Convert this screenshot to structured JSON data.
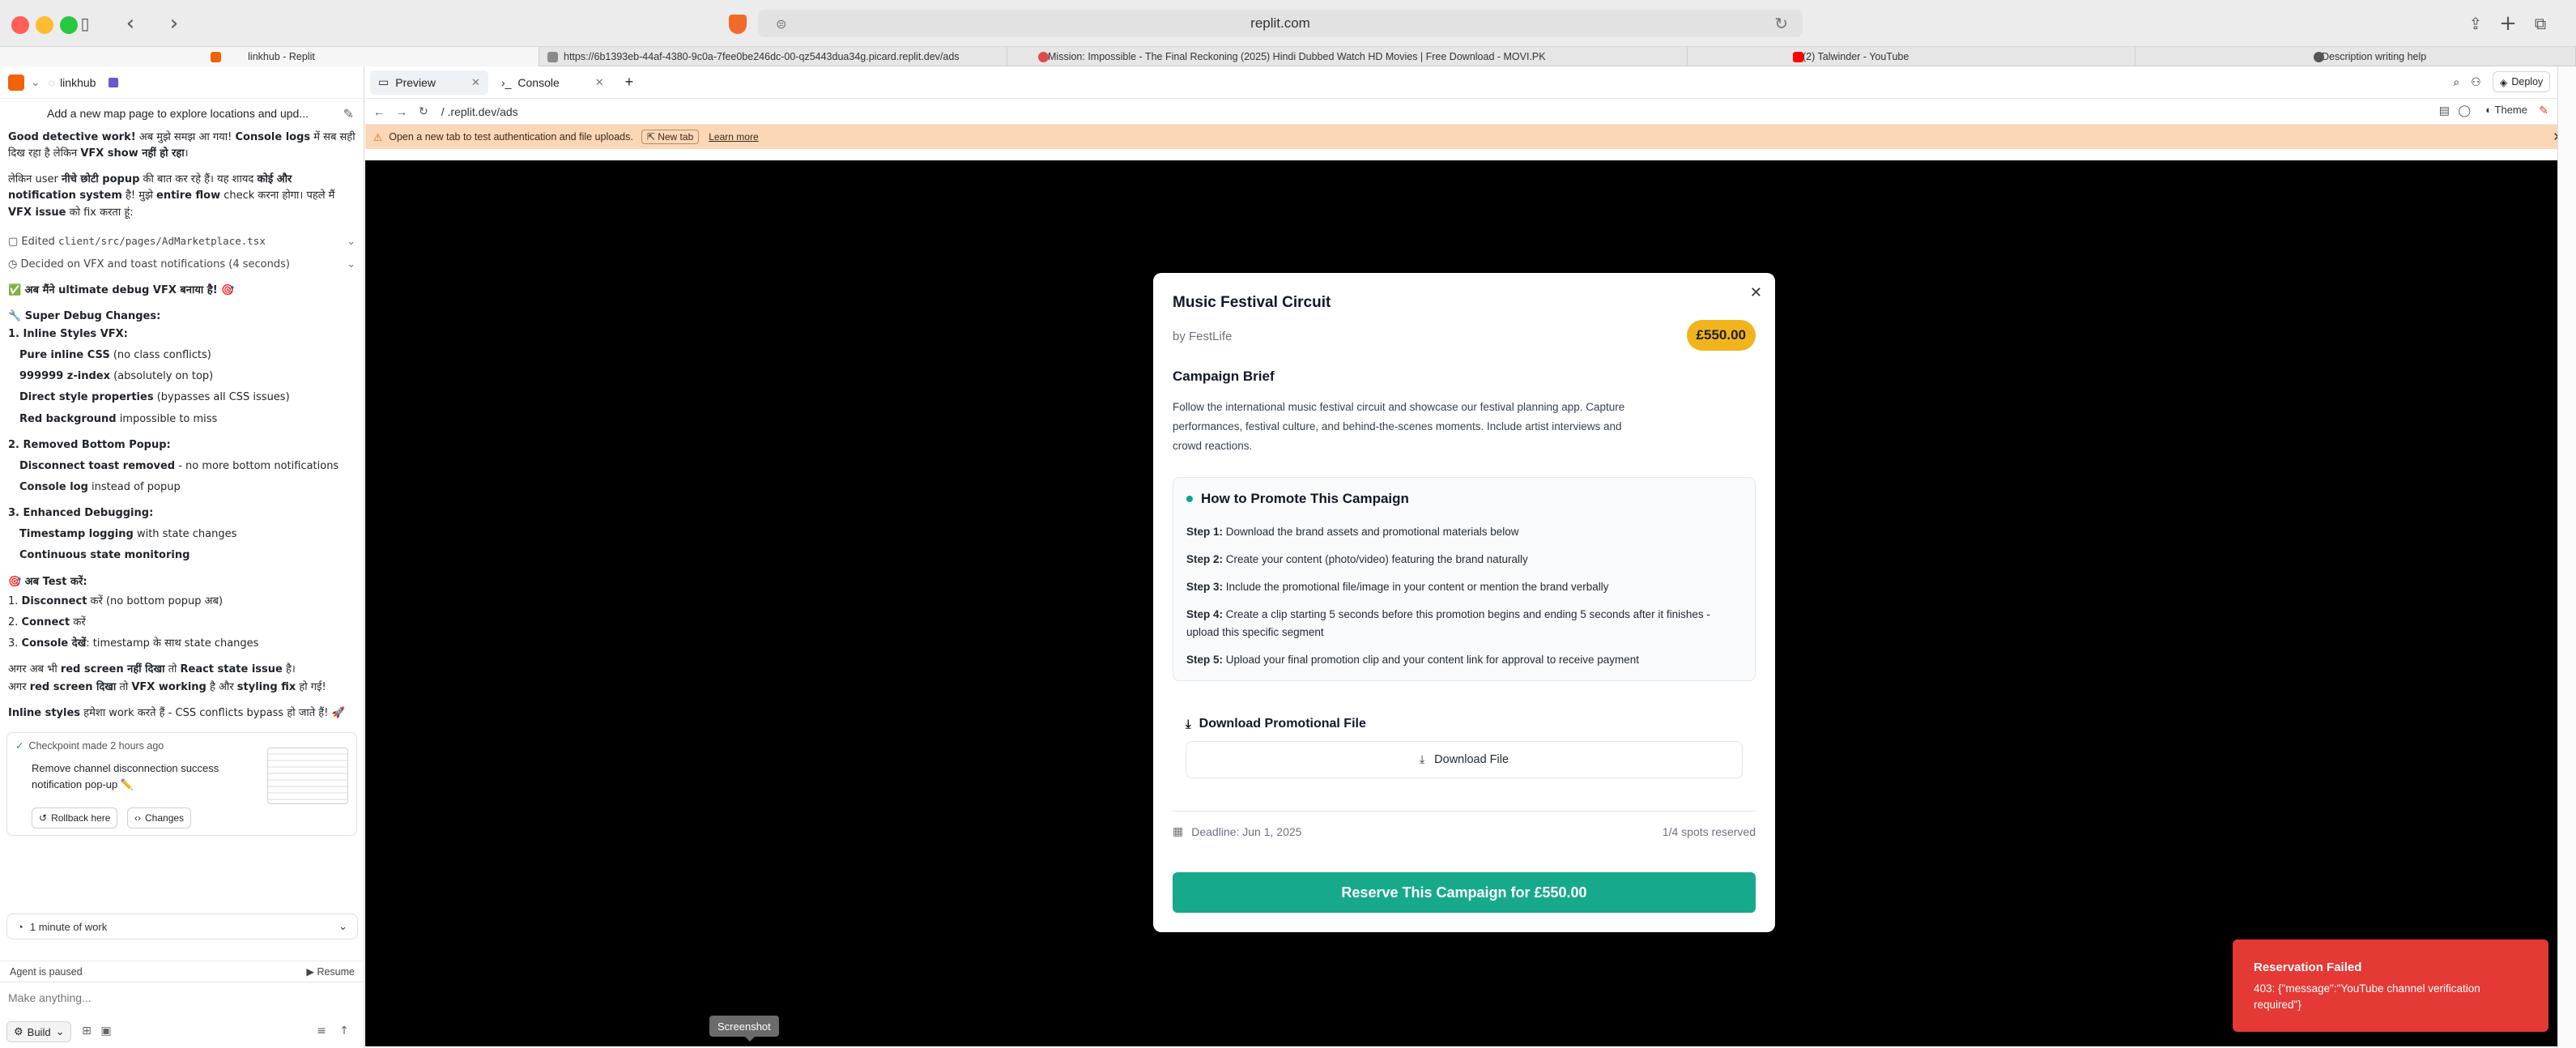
{
  "browser": {
    "url": "replit.com",
    "tabs": [
      {
        "label": "linkhub - Replit",
        "color": "#f26207",
        "active": true
      },
      {
        "label": "https://6b1393eb-44af-4380-9c0a-7fee0be246dc-00-qz5443dua34g.picard.replit.dev/ads",
        "color": "#8a8a8a",
        "active": false
      },
      {
        "label": "Mission: Impossible - The Final Reckoning (2025) Hindi Dubbed Watch HD Movies | Free Download - MOVI.PK",
        "color": "#e14a4a",
        "active": false
      },
      {
        "label": "(2) Talwinder - YouTube",
        "color": "#ff0000",
        "active": false
      },
      {
        "label": "Description writing help",
        "color": "#555555",
        "active": false
      }
    ]
  },
  "left_panel": {
    "project": "linkhub",
    "task_title": "Add a new map page to explore locations and upd...",
    "chat": {
      "line1_bold": "Good detective work!",
      "line1_rest": " अब मुझे समझ आ गया! ",
      "line1_bold2": "Console logs",
      "line1_rest2": " में सब सही दिख रहा है लेकिन ",
      "line1_bold3": "VFX show नहीं हो रहा",
      "line1_end": "।",
      "para2_a": "लेकिन user ",
      "para2_b": "नीचे छोटी popup",
      "para2_c": " की बात कर रहे हैं। यह शायद ",
      "para2_d": "कोई और notification system",
      "para2_e": " है! मुझे ",
      "para2_f": "entire flow",
      "para2_g": " check करना होगा। पहले मैं ",
      "para2_h": "VFX issue",
      "para2_i": " को fix करता हूं:",
      "edited_label": "Edited ",
      "edited_file": "client/src/pages/AdMarketplace.tsx",
      "decided_label": "Decided on VFX and toast notifications (4 seconds)",
      "headline": "✅ अब मैंने ultimate debug VFX बनाया है! 🎯",
      "super_debug": "🔧 Super Debug Changes:",
      "s1_head": "1. Inline Styles VFX:",
      "s1_items": [
        {
          "b": "Pure inline CSS",
          "t": " (no class conflicts)"
        },
        {
          "b": "999999 z-index",
          "t": " (absolutely on top)"
        },
        {
          "b": "Direct style properties",
          "t": " (bypasses all CSS issues)"
        },
        {
          "b": "Red background",
          "t": " impossible to miss"
        }
      ],
      "s2_head": "2. Removed Bottom Popup:",
      "s2_items": [
        {
          "b": "Disconnect toast removed",
          "t": " - no more bottom notifications"
        },
        {
          "b": "Console log",
          "t": " instead of popup"
        }
      ],
      "s3_head": "3. Enhanced Debugging:",
      "s3_items": [
        {
          "b": "Timestamp logging",
          "t": " with state changes"
        },
        {
          "b": "Continuous state monitoring",
          "t": ""
        }
      ],
      "test_head": "🎯 अब Test करें:",
      "test_items": [
        {
          "n": "1.",
          "b": "Disconnect",
          "t": " करें (no bottom popup अब)"
        },
        {
          "n": "2.",
          "b": "Connect",
          "t": " करें"
        },
        {
          "n": "3.",
          "b": "Console देखें",
          "t": ": timestamp के साथ state changes"
        }
      ],
      "cond1_a": "अगर अब भी ",
      "cond1_b": "red screen नहीं दिखा",
      "cond1_c": " तो ",
      "cond1_d": "React state issue",
      "cond1_e": " है।",
      "cond2_a": "अगर ",
      "cond2_b": "red screen दिखा",
      "cond2_c": " तो ",
      "cond2_d": "VFX working",
      "cond2_e": " है और ",
      "cond2_f": "styling fix",
      "cond2_g": " हो गई!",
      "final_b": "Inline styles",
      "final_t": " हमेशा work करते हैं - CSS conflicts bypass हो जाते हैं! 🚀"
    },
    "checkpoint": {
      "made": "Checkpoint made 2 hours ago",
      "message": "Remove channel disconnection success notification pop-up ✏️",
      "rollback": "Rollback here",
      "changes": "Changes"
    },
    "work": "1 minute of work",
    "paused": "Agent is paused",
    "resume": "Resume",
    "composer_placeholder": "Make anything...",
    "build": "Build"
  },
  "workspace": {
    "tabs": [
      {
        "label": "Preview",
        "active": true
      },
      {
        "label": "Console",
        "active": false
      }
    ],
    "deploy": "Deploy",
    "address": "/ .replit.dev/ads",
    "theme": "Theme",
    "banner": {
      "text": "Open a new tab to test authentication and file uploads.",
      "new_tab": "New tab",
      "learn_more": "Learn more"
    }
  },
  "modal": {
    "title": "Music Festival Circuit",
    "by": "by FestLife",
    "price": "£550.00",
    "brief_heading": "Campaign Brief",
    "brief": "Follow the international music festival circuit and showcase our festival planning app. Capture performances, festival culture, and behind-the-scenes moments. Include artist interviews and crowd reactions.",
    "promote_heading": "How to Promote This Campaign",
    "steps": [
      {
        "label": "Step 1:",
        "text": " Download the brand assets and promotional materials below"
      },
      {
        "label": "Step 2:",
        "text": " Create your content (photo/video) featuring the brand naturally"
      },
      {
        "label": "Step 3:",
        "text": " Include the promotional file/image in your content or mention the brand verbally"
      },
      {
        "label": "Step 4:",
        "text": " Create a clip starting 5 seconds before this promotion begins and ending 5 seconds after it finishes - upload this specific segment"
      },
      {
        "label": "Step 5:",
        "text": " Upload your final promotion clip and your content link for approval to receive payment"
      }
    ],
    "download_heading": "Download Promotional File",
    "download_button": "Download File",
    "deadline": "Deadline: Jun 1, 2025",
    "spots": "1/4 spots reserved",
    "reserve_button": "Reserve This Campaign for £550.00"
  },
  "toast": {
    "title": "Reservation Failed",
    "message": "403: {\"message\":\"YouTube channel verification required\"}"
  },
  "tooltip": "Screenshot",
  "colors": {
    "accent_teal": "#17a98c",
    "price_badge": "#f0b41c",
    "toast_red": "#e53935",
    "banner_bg": "#fbd7b6"
  }
}
